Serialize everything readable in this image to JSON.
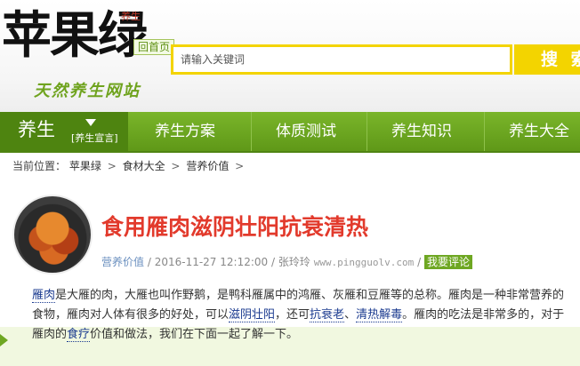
{
  "header": {
    "logo_text": "苹果绿",
    "logo_seal": "养生",
    "logo_tagline": "天然养生网站",
    "home_link": "回首页",
    "search": {
      "placeholder": "请输入关键词",
      "button_label": "搜 索"
    }
  },
  "nav": {
    "home": {
      "label": "养生",
      "tag": "[养生宣言]"
    },
    "items": [
      {
        "label": "养生方案"
      },
      {
        "label": "体质测试"
      },
      {
        "label": "养生知识"
      },
      {
        "label": "养生大全"
      }
    ]
  },
  "breadcrumb": {
    "prefix": "当前位置：",
    "items": [
      "苹果绿",
      "食材大全",
      "营养价值"
    ],
    "separator": ">"
  },
  "article": {
    "title": "食用雁肉滋阴壮阳抗衰清热",
    "meta": {
      "category": "营养价值",
      "date": "2016-11-27 12:12:00",
      "author": "张玲玲",
      "url": "www.pingguolv.com",
      "comment_button": "我要评论"
    },
    "paragraph": {
      "kw1": "雁肉",
      "t1": "是大雁的肉，大雁也叫作野鹅，是鸭科雁属中的鸿雁、灰雁和豆雁等的总称。雁肉是一种非常营养的食物，雁肉对人体有很多的好处，可以",
      "kw2": "滋阴壮阳",
      "t2": "，还可",
      "kw3": "抗衰老",
      "t3": "、",
      "kw4": "清热解毒",
      "t4": "。雁肉的吃法是非常多的，对于雁肉的",
      "kw5": "食疗",
      "t5": "价值和做法，我们在下面一起了解一下。"
    }
  },
  "colors": {
    "nav_green": "#6ea722",
    "search_yellow": "#f3d400",
    "title_red": "#e23a2c"
  }
}
